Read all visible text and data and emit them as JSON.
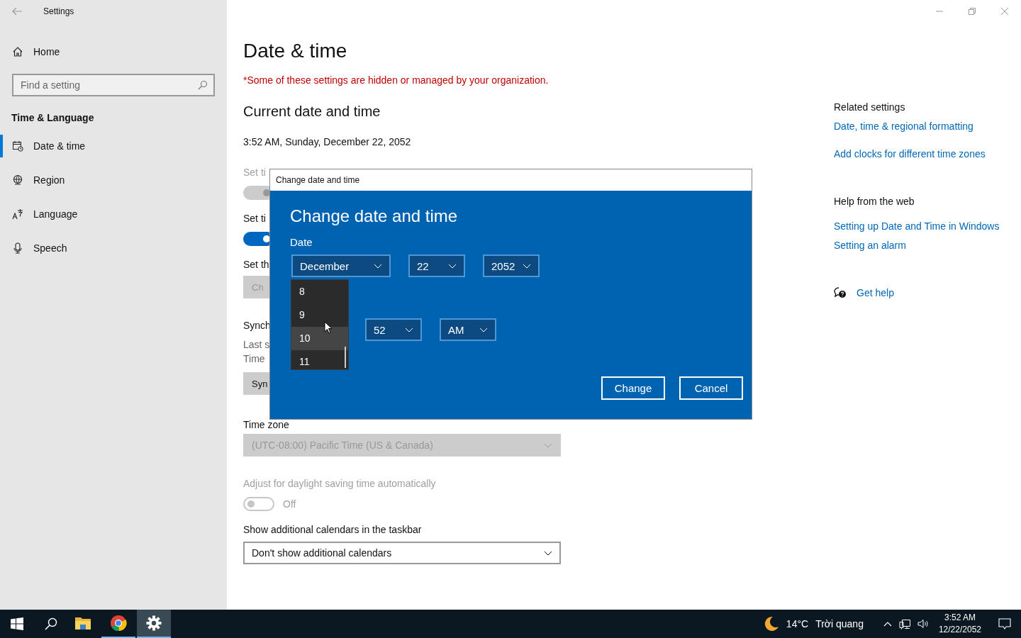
{
  "window": {
    "title": "Settings"
  },
  "sidebar": {
    "home": "Home",
    "search": {
      "placeholder": "Find a setting"
    },
    "section": "Time & Language",
    "items": [
      {
        "label": "Date & time",
        "kind": "calendar",
        "selected": true
      },
      {
        "label": "Region",
        "kind": "globe",
        "selected": false
      },
      {
        "label": "Language",
        "kind": "language",
        "selected": false
      },
      {
        "label": "Speech",
        "kind": "microphone",
        "selected": false
      }
    ]
  },
  "page": {
    "title": "Date & time",
    "notice": "*Some of these settings are hidden or managed by your organization.",
    "heading": "Current date and time",
    "current": "3:52 AM, Sunday, December 22, 2052",
    "covered": [
      {
        "kind": "label",
        "text": "Set ti",
        "disabled": true
      },
      {
        "kind": "toggle",
        "on": true,
        "disabled": true
      },
      {
        "kind": "label",
        "text": "Set ti",
        "disabled": false
      },
      {
        "kind": "toggle",
        "on": true,
        "disabled": false
      },
      {
        "kind": "label",
        "text": "Set th",
        "disabled": false
      },
      {
        "kind": "button",
        "text": "Ch",
        "disabled": true
      },
      {
        "kind": "label",
        "text": "Synch",
        "disabled": false
      },
      {
        "kind": "note",
        "text": "Last s",
        "disabled": false
      },
      {
        "kind": "note",
        "text": "Time",
        "disabled": false
      },
      {
        "kind": "button",
        "text": "Syn",
        "disabled": false
      }
    ],
    "time_zone": {
      "label": "Time zone",
      "value": "(UTC-08:00) Pacific Time (US & Canada)",
      "disabled": true
    },
    "daylight": {
      "label": "Adjust for daylight saving time automatically",
      "on": false,
      "disabled": true,
      "state": "Off"
    },
    "calendars": {
      "label": "Show additional calendars in the taskbar",
      "value": "Don't show additional calendars",
      "disabled": false
    }
  },
  "related": {
    "heading": "Related settings",
    "links": [
      "Date, time & regional formatting",
      "Add clocks for different time zones"
    ]
  },
  "help": {
    "heading": "Help from the web",
    "links": [
      "Setting up Date and Time in Windows",
      "Setting an alarm"
    ],
    "get_help": "Get help"
  },
  "dialog": {
    "title": "Change date and time",
    "heading": "Change date and time",
    "date_label": "Date",
    "date": [
      "December",
      "22",
      "2052"
    ],
    "time": [
      "52",
      "AM"
    ],
    "hour_options": [
      {
        "label": "8",
        "selected": false
      },
      {
        "label": "9",
        "selected": false
      },
      {
        "label": "10",
        "selected": true
      },
      {
        "label": "11",
        "selected": false
      }
    ],
    "buttons": [
      "Change",
      "Cancel"
    ]
  },
  "taskbar": {
    "apps": [
      {
        "kind": "explorer",
        "running": false,
        "selected": false
      },
      {
        "kind": "browser",
        "running": true,
        "selected": false
      },
      {
        "kind": "settings",
        "running": true,
        "selected": true
      }
    ],
    "weather": {
      "temp": "14°C",
      "text": "Trời quang"
    },
    "time": "3:52 AM",
    "date": "12/22/2052"
  }
}
